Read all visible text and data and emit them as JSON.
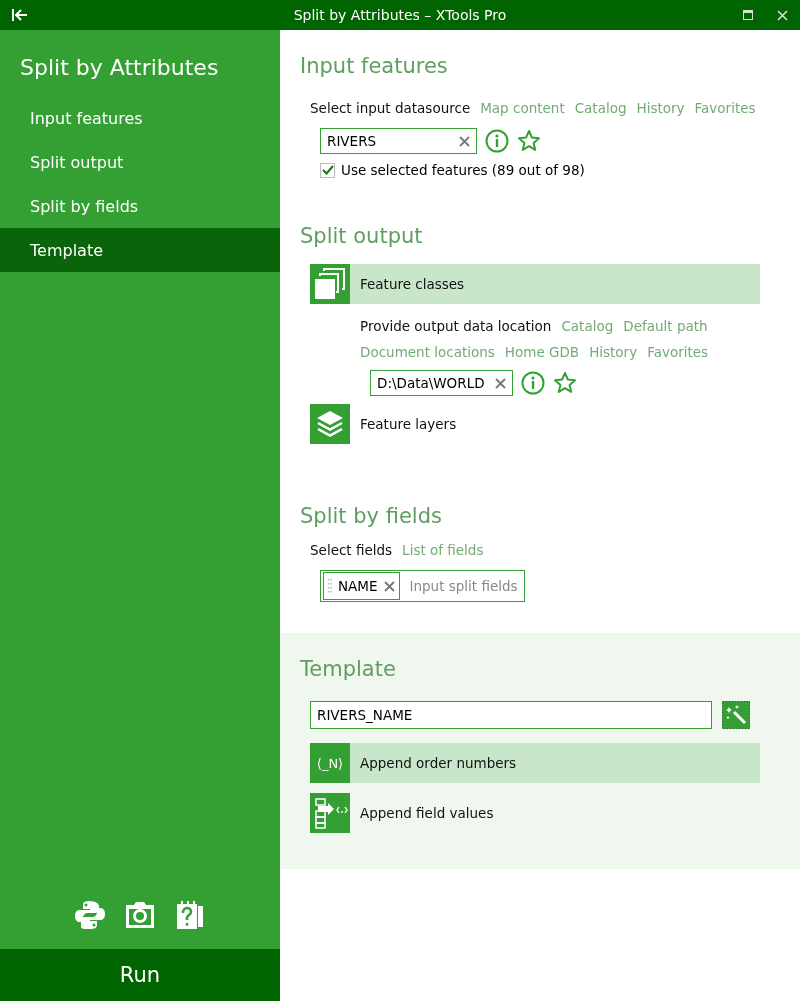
{
  "window": {
    "title": "Split by Attributes – XTools Pro"
  },
  "sidebar": {
    "title": "Split by Attributes",
    "items": [
      {
        "label": "Input features",
        "selected": false
      },
      {
        "label": "Split output",
        "selected": false
      },
      {
        "label": "Split by fields",
        "selected": false
      },
      {
        "label": "Template",
        "selected": true
      }
    ],
    "run_button": "Run"
  },
  "input_features": {
    "title": "Input features",
    "prompt": "Select input datasource",
    "links": [
      "Map content",
      "Catalog",
      "History",
      "Favorites"
    ],
    "value": "RIVERS",
    "use_selected": {
      "label": "Use selected features (89 out of 98)",
      "checked": true
    }
  },
  "split_output": {
    "title": "Split output",
    "options": [
      {
        "kind": "classes",
        "label": "Feature classes",
        "selected": true
      },
      {
        "kind": "layers",
        "label": "Feature layers",
        "selected": false
      }
    ],
    "prompt": "Provide output data location",
    "links": [
      "Catalog",
      "Default path",
      "Document locations",
      "Home GDB",
      "History",
      "Favorites"
    ],
    "value": "D:\\Data\\WORLD"
  },
  "split_by_fields": {
    "title": "Split by fields",
    "prompt": "Select fields",
    "links": [
      "List of fields"
    ],
    "tags": [
      "NAME"
    ],
    "placeholder": "Input split fields"
  },
  "template": {
    "title": "Template",
    "value": "RIVERS_NAME",
    "options": [
      {
        "kind": "order",
        "label": "Append order numbers",
        "icon_text": "⟨_N⟩",
        "selected": true
      },
      {
        "kind": "values",
        "label": "Append field values",
        "selected": false
      }
    ]
  }
}
